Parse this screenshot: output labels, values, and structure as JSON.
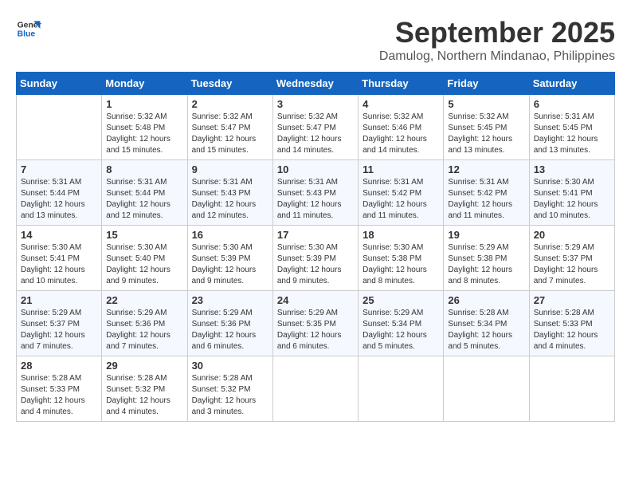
{
  "header": {
    "logo_line1": "General",
    "logo_line2": "Blue",
    "month_title": "September 2025",
    "subtitle": "Damulog, Northern Mindanao, Philippines"
  },
  "weekdays": [
    "Sunday",
    "Monday",
    "Tuesday",
    "Wednesday",
    "Thursday",
    "Friday",
    "Saturday"
  ],
  "weeks": [
    [
      {
        "day": "",
        "sunrise": "",
        "sunset": "",
        "daylight": ""
      },
      {
        "day": "1",
        "sunrise": "Sunrise: 5:32 AM",
        "sunset": "Sunset: 5:48 PM",
        "daylight": "Daylight: 12 hours and 15 minutes."
      },
      {
        "day": "2",
        "sunrise": "Sunrise: 5:32 AM",
        "sunset": "Sunset: 5:47 PM",
        "daylight": "Daylight: 12 hours and 15 minutes."
      },
      {
        "day": "3",
        "sunrise": "Sunrise: 5:32 AM",
        "sunset": "Sunset: 5:47 PM",
        "daylight": "Daylight: 12 hours and 14 minutes."
      },
      {
        "day": "4",
        "sunrise": "Sunrise: 5:32 AM",
        "sunset": "Sunset: 5:46 PM",
        "daylight": "Daylight: 12 hours and 14 minutes."
      },
      {
        "day": "5",
        "sunrise": "Sunrise: 5:32 AM",
        "sunset": "Sunset: 5:45 PM",
        "daylight": "Daylight: 12 hours and 13 minutes."
      },
      {
        "day": "6",
        "sunrise": "Sunrise: 5:31 AM",
        "sunset": "Sunset: 5:45 PM",
        "daylight": "Daylight: 12 hours and 13 minutes."
      }
    ],
    [
      {
        "day": "7",
        "sunrise": "Sunrise: 5:31 AM",
        "sunset": "Sunset: 5:44 PM",
        "daylight": "Daylight: 12 hours and 13 minutes."
      },
      {
        "day": "8",
        "sunrise": "Sunrise: 5:31 AM",
        "sunset": "Sunset: 5:44 PM",
        "daylight": "Daylight: 12 hours and 12 minutes."
      },
      {
        "day": "9",
        "sunrise": "Sunrise: 5:31 AM",
        "sunset": "Sunset: 5:43 PM",
        "daylight": "Daylight: 12 hours and 12 minutes."
      },
      {
        "day": "10",
        "sunrise": "Sunrise: 5:31 AM",
        "sunset": "Sunset: 5:43 PM",
        "daylight": "Daylight: 12 hours and 11 minutes."
      },
      {
        "day": "11",
        "sunrise": "Sunrise: 5:31 AM",
        "sunset": "Sunset: 5:42 PM",
        "daylight": "Daylight: 12 hours and 11 minutes."
      },
      {
        "day": "12",
        "sunrise": "Sunrise: 5:31 AM",
        "sunset": "Sunset: 5:42 PM",
        "daylight": "Daylight: 12 hours and 11 minutes."
      },
      {
        "day": "13",
        "sunrise": "Sunrise: 5:30 AM",
        "sunset": "Sunset: 5:41 PM",
        "daylight": "Daylight: 12 hours and 10 minutes."
      }
    ],
    [
      {
        "day": "14",
        "sunrise": "Sunrise: 5:30 AM",
        "sunset": "Sunset: 5:41 PM",
        "daylight": "Daylight: 12 hours and 10 minutes."
      },
      {
        "day": "15",
        "sunrise": "Sunrise: 5:30 AM",
        "sunset": "Sunset: 5:40 PM",
        "daylight": "Daylight: 12 hours and 9 minutes."
      },
      {
        "day": "16",
        "sunrise": "Sunrise: 5:30 AM",
        "sunset": "Sunset: 5:39 PM",
        "daylight": "Daylight: 12 hours and 9 minutes."
      },
      {
        "day": "17",
        "sunrise": "Sunrise: 5:30 AM",
        "sunset": "Sunset: 5:39 PM",
        "daylight": "Daylight: 12 hours and 9 minutes."
      },
      {
        "day": "18",
        "sunrise": "Sunrise: 5:30 AM",
        "sunset": "Sunset: 5:38 PM",
        "daylight": "Daylight: 12 hours and 8 minutes."
      },
      {
        "day": "19",
        "sunrise": "Sunrise: 5:29 AM",
        "sunset": "Sunset: 5:38 PM",
        "daylight": "Daylight: 12 hours and 8 minutes."
      },
      {
        "day": "20",
        "sunrise": "Sunrise: 5:29 AM",
        "sunset": "Sunset: 5:37 PM",
        "daylight": "Daylight: 12 hours and 7 minutes."
      }
    ],
    [
      {
        "day": "21",
        "sunrise": "Sunrise: 5:29 AM",
        "sunset": "Sunset: 5:37 PM",
        "daylight": "Daylight: 12 hours and 7 minutes."
      },
      {
        "day": "22",
        "sunrise": "Sunrise: 5:29 AM",
        "sunset": "Sunset: 5:36 PM",
        "daylight": "Daylight: 12 hours and 7 minutes."
      },
      {
        "day": "23",
        "sunrise": "Sunrise: 5:29 AM",
        "sunset": "Sunset: 5:36 PM",
        "daylight": "Daylight: 12 hours and 6 minutes."
      },
      {
        "day": "24",
        "sunrise": "Sunrise: 5:29 AM",
        "sunset": "Sunset: 5:35 PM",
        "daylight": "Daylight: 12 hours and 6 minutes."
      },
      {
        "day": "25",
        "sunrise": "Sunrise: 5:29 AM",
        "sunset": "Sunset: 5:34 PM",
        "daylight": "Daylight: 12 hours and 5 minutes."
      },
      {
        "day": "26",
        "sunrise": "Sunrise: 5:28 AM",
        "sunset": "Sunset: 5:34 PM",
        "daylight": "Daylight: 12 hours and 5 minutes."
      },
      {
        "day": "27",
        "sunrise": "Sunrise: 5:28 AM",
        "sunset": "Sunset: 5:33 PM",
        "daylight": "Daylight: 12 hours and 4 minutes."
      }
    ],
    [
      {
        "day": "28",
        "sunrise": "Sunrise: 5:28 AM",
        "sunset": "Sunset: 5:33 PM",
        "daylight": "Daylight: 12 hours and 4 minutes."
      },
      {
        "day": "29",
        "sunrise": "Sunrise: 5:28 AM",
        "sunset": "Sunset: 5:32 PM",
        "daylight": "Daylight: 12 hours and 4 minutes."
      },
      {
        "day": "30",
        "sunrise": "Sunrise: 5:28 AM",
        "sunset": "Sunset: 5:32 PM",
        "daylight": "Daylight: 12 hours and 3 minutes."
      },
      {
        "day": "",
        "sunrise": "",
        "sunset": "",
        "daylight": ""
      },
      {
        "day": "",
        "sunrise": "",
        "sunset": "",
        "daylight": ""
      },
      {
        "day": "",
        "sunrise": "",
        "sunset": "",
        "daylight": ""
      },
      {
        "day": "",
        "sunrise": "",
        "sunset": "",
        "daylight": ""
      }
    ]
  ]
}
